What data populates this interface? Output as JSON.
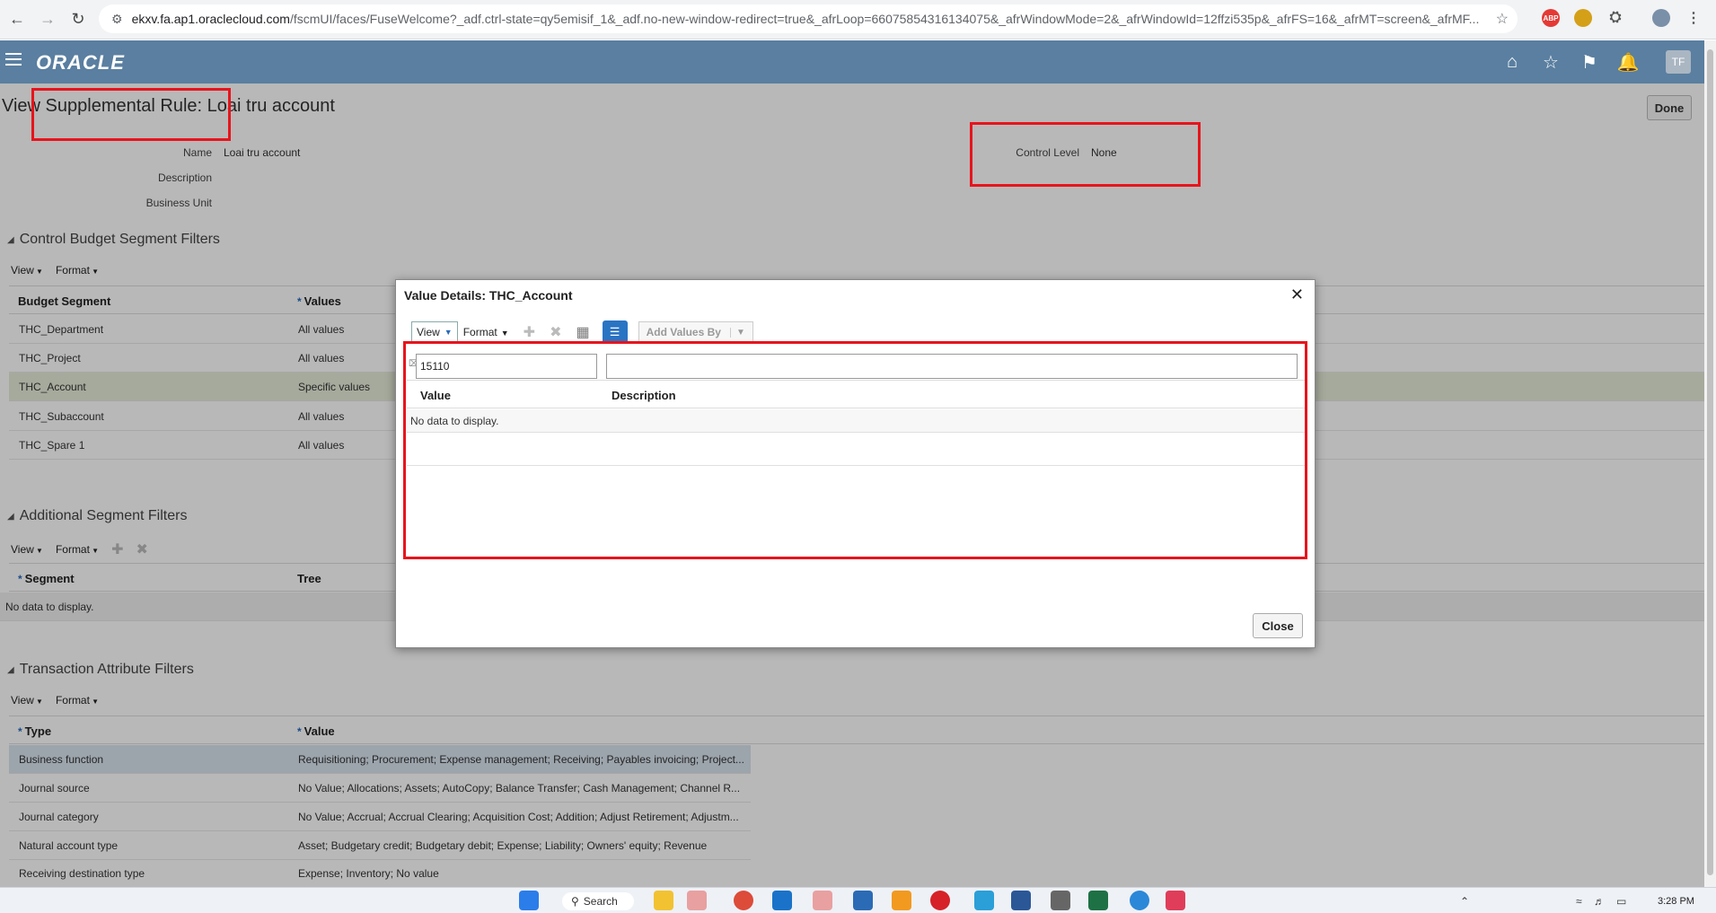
{
  "browser": {
    "url_host": "ekxv.fa.ap1.oraclecloud.com",
    "url_rest": "/fscmUI/faces/FuseWelcome?_adf.ctrl-state=qy5emisif_1&_adf.no-new-window-redirect=true&_afrLoop=66075854316134075&_afrWindowMode=2&_afrWindowId=12ffzi535p&_afrFS=16&_afrMT=screen&_afrMF..."
  },
  "header": {
    "brand": "ORACLE",
    "avatar": "TF"
  },
  "page": {
    "title": "View Supplemental Rule: Loai tru account",
    "done_label": "Done",
    "name_label": "Name",
    "name_value": "Loai tru account",
    "description_label": "Description",
    "business_unit_label": "Business Unit",
    "control_level_label": "Control Level",
    "control_level_value": "None"
  },
  "control_budget": {
    "title": "Control Budget Segment Filters",
    "view_label": "View",
    "format_label": "Format",
    "col_segment": "Budget Segment",
    "col_values": "Values",
    "rows": [
      {
        "segment": "THC_Department",
        "values": "All values"
      },
      {
        "segment": "THC_Project",
        "values": "All values"
      },
      {
        "segment": "THC_Account",
        "values": "Specific values"
      },
      {
        "segment": "THC_Subaccount",
        "values": "All values"
      },
      {
        "segment": "THC_Spare 1",
        "values": "All values"
      }
    ]
  },
  "additional": {
    "title": "Additional Segment Filters",
    "view_label": "View",
    "format_label": "Format",
    "col_segment": "Segment",
    "col_tree": "Tree",
    "no_data": "No data to display."
  },
  "transaction": {
    "title": "Transaction Attribute Filters",
    "view_label": "View",
    "format_label": "Format",
    "col_type": "Type",
    "col_value": "Value",
    "rows": [
      {
        "type": "Business function",
        "value": "Requisitioning; Procurement; Expense management; Receiving; Payables invoicing; Project..."
      },
      {
        "type": "Journal source",
        "value": "No Value; Allocations; Assets; AutoCopy; Balance Transfer; Cash Management; Channel R..."
      },
      {
        "type": "Journal category",
        "value": "No Value; Accrual; Accrual Clearing; Acquisition Cost; Addition; Adjust Retirement; Adjustm..."
      },
      {
        "type": "Natural account type",
        "value": "Asset; Budgetary credit; Budgetary debit; Expense; Liability; Owners' equity; Revenue"
      },
      {
        "type": "Receiving destination type",
        "value": "Expense; Inventory; No value"
      }
    ]
  },
  "dialog": {
    "title": "Value Details: THC_Account",
    "view_label": "View",
    "format_label": "Format",
    "add_values_label": "Add Values By",
    "filter_value": "15110",
    "filter_description": "",
    "col_value": "Value",
    "col_description": "Description",
    "no_data": "No data to display.",
    "close_label": "Close"
  },
  "taskbar": {
    "search_label": "Search",
    "time": "3:28 PM"
  }
}
